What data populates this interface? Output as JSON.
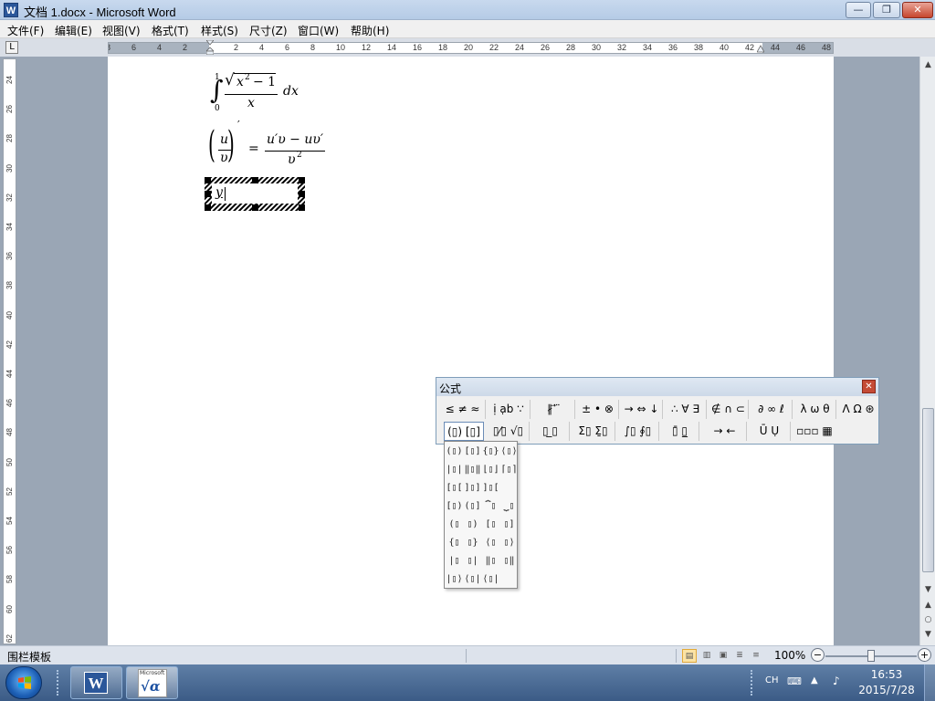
{
  "window": {
    "title": "文档 1.docx - Microsoft Word",
    "app_icon_glyph": "W",
    "min_glyph": "—",
    "max_glyph": "❐",
    "close_glyph": "✕"
  },
  "menu": [
    "文件(F)",
    "编辑(E)",
    "视图(V)",
    "格式(T)",
    "样式(S)",
    "尺寸(Z)",
    "窗口(W)",
    "帮助(H)"
  ],
  "ruler": {
    "horizontal_labels": [
      "8",
      "6",
      "4",
      "2",
      "",
      "2",
      "4",
      "6",
      "8",
      "10",
      "12",
      "14",
      "16",
      "18",
      "20",
      "22",
      "24",
      "26",
      "28",
      "30",
      "32",
      "34",
      "36",
      "38",
      "40",
      "42",
      "44",
      "46",
      "48"
    ],
    "vertical_labels": [
      "24",
      "26",
      "28",
      "30",
      "32",
      "34",
      "36",
      "38",
      "40",
      "42",
      "44",
      "46",
      "48",
      "50",
      "52",
      "54",
      "56",
      "58",
      "60",
      "62"
    ]
  },
  "equations": {
    "integral_upper": "1",
    "integral_lower": "0",
    "integral_sign": "∫",
    "sqrt_sign": "√",
    "radicand": "x",
    "radicand_exp": "2",
    "radicand_tail": "− 1",
    "denominator_x": "x",
    "dx": "dx",
    "lhs_num": "u",
    "lhs_den": "υ",
    "prime": "′",
    "equals": "=",
    "rhs_num": "u′υ − uυ′",
    "rhs_den": "υ",
    "rhs_den_exp": "2",
    "editing_text": "y"
  },
  "eq_toolbar": {
    "title": "公式",
    "close_glyph": "✕",
    "row1": [
      "≤ ≠ ≈",
      "ị ạb ∵",
      "∦ ⃗ ⃛",
      "± • ⊗",
      "→ ⇔ ↓",
      "∴ ∀ ∃",
      "∉ ∩ ⊂",
      "∂ ∞ ℓ",
      "λ ω θ",
      "Λ Ω ⊛"
    ],
    "row2": [
      "(▯) [▯]",
      "▯⁄▯ √▯",
      "▯ ̲▯",
      "Σ▯ Σ̱▯",
      "∫▯ ∮▯",
      "▯̄ ▯̲",
      "→ ←",
      "Ū Ụ",
      "▫▫▫ ▦"
    ]
  },
  "palette": {
    "cells": [
      "(▯)",
      "[▯]",
      "{▯}",
      "⟨▯⟩",
      "|▯|",
      "‖▯‖",
      "⌊▯⌋",
      "⌈▯⌉",
      "[▯[",
      "]▯]",
      "]▯[",
      "",
      "[▯)",
      "(▯]",
      "⏞▯",
      "⏟▯",
      "(▯",
      "▯)",
      "[▯",
      "▯]",
      "{▯",
      "▯}",
      "⟨▯",
      "▯⟩",
      "|▯",
      "▯|",
      "‖▯",
      "▯‖",
      "|▯⟩",
      "⟨▯|",
      "⟨▯|▯⟩",
      ""
    ]
  },
  "statusbar": {
    "left_text": "围栏模板",
    "zoom": "100%",
    "zoom_minus": "−",
    "zoom_plus": "+",
    "zoom_level": 0.5
  },
  "taskbar": {
    "word_glyph": "W",
    "mathtype_label": "Microsoft",
    "mathtype_glyph": "√α",
    "ime": "CH",
    "time": "16:53",
    "date": "2015/7/28"
  },
  "colors": {
    "accent": "#2b579a",
    "close_red": "#c7462e"
  }
}
